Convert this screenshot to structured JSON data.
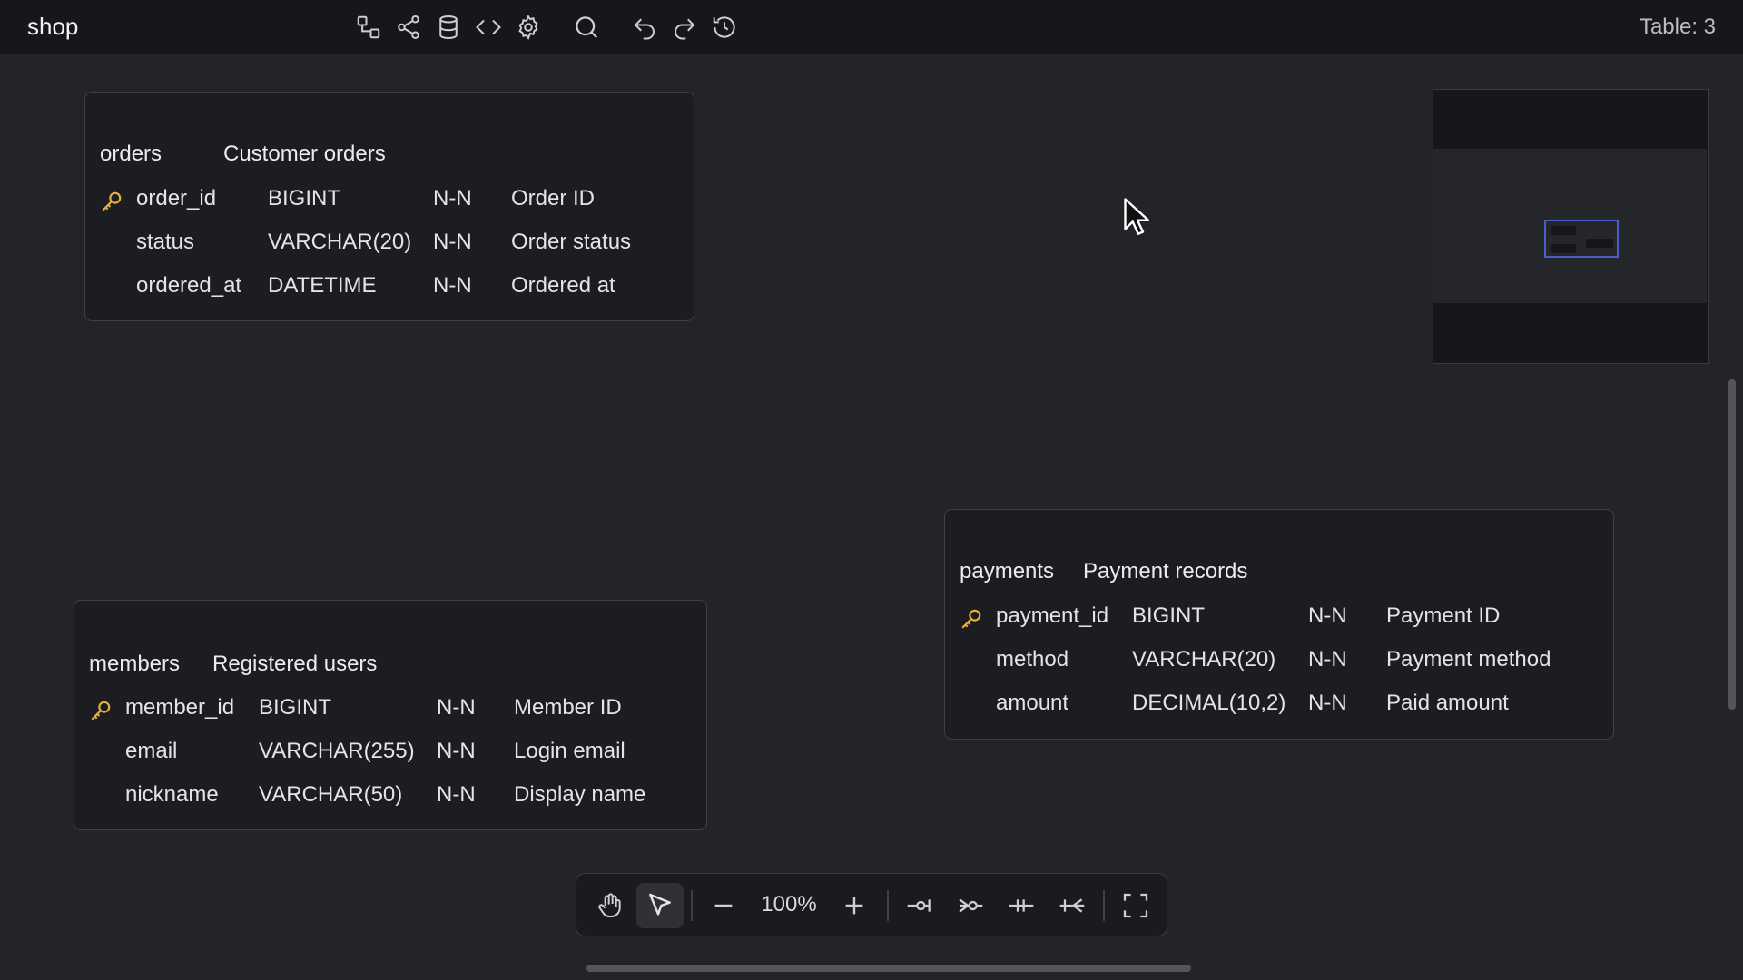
{
  "header": {
    "title": "shop",
    "table_count": "Table: 3",
    "tools": [
      {
        "name": "diagram-icon"
      },
      {
        "name": "share-icon"
      },
      {
        "name": "database-icon"
      },
      {
        "name": "code-icon"
      },
      {
        "name": "gear-icon"
      },
      {
        "name": "search-icon"
      },
      {
        "name": "undo-icon"
      },
      {
        "name": "redo-icon"
      },
      {
        "name": "history-icon"
      }
    ]
  },
  "tables": {
    "orders": {
      "name": "orders",
      "comment": "Customer orders",
      "columns": [
        {
          "name": "order_id",
          "type": "BIGINT",
          "nullability": "N-N",
          "comment": "Order ID",
          "pk": true
        },
        {
          "name": "status",
          "type": "VARCHAR(20)",
          "nullability": "N-N",
          "comment": "Order status",
          "pk": false
        },
        {
          "name": "ordered_at",
          "type": "DATETIME",
          "nullability": "N-N",
          "comment": "Ordered at",
          "pk": false
        }
      ]
    },
    "members": {
      "name": "members",
      "comment": "Registered users",
      "columns": [
        {
          "name": "member_id",
          "type": "BIGINT",
          "nullability": "N-N",
          "comment": "Member ID",
          "pk": true
        },
        {
          "name": "email",
          "type": "VARCHAR(255)",
          "nullability": "N-N",
          "comment": "Login email",
          "pk": false
        },
        {
          "name": "nickname",
          "type": "VARCHAR(50)",
          "nullability": "N-N",
          "comment": "Display name",
          "pk": false
        }
      ]
    },
    "payments": {
      "name": "payments",
      "comment": "Payment records",
      "columns": [
        {
          "name": "payment_id",
          "type": "BIGINT",
          "nullability": "N-N",
          "comment": "Payment ID",
          "pk": true
        },
        {
          "name": "method",
          "type": "VARCHAR(20)",
          "nullability": "N-N",
          "comment": "Payment method",
          "pk": false
        },
        {
          "name": "amount",
          "type": "DECIMAL(10,2)",
          "nullability": "N-N",
          "comment": "Paid amount",
          "pk": false
        }
      ]
    }
  },
  "bottom_toolbar": {
    "zoom": "100%",
    "items": [
      "hand-icon",
      "pointer-icon",
      "zoom-out-icon",
      "zoom-in-icon",
      "relation-one-icon",
      "relation-many-icon",
      "relation-one-one-icon",
      "relation-one-many-icon",
      "fullscreen-icon"
    ]
  },
  "colors": {
    "background": "#232428",
    "header": "#16171a",
    "key_icon": "#e8b03a",
    "minimap_viewport": "#4a5fc8"
  }
}
